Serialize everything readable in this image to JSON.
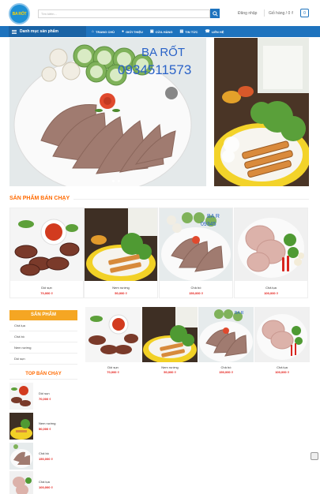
{
  "header": {
    "logo_text": "BA RỐT",
    "search_placeholder": "Tìm kiếm...",
    "login": "Đăng nhập",
    "cart": "Giỏ hàng / 0 ₫",
    "cart_count": "0"
  },
  "nav": {
    "category_menu": "Danh mục sản phẩm",
    "items": [
      {
        "label": "TRANG CHỦ",
        "icon": "home-icon"
      },
      {
        "label": "GIỚI THIỆU",
        "icon": "info-icon"
      },
      {
        "label": "CỬA HÀNG",
        "icon": "cart-icon"
      },
      {
        "label": "TIN TỨC",
        "icon": "news-icon"
      },
      {
        "label": "LIÊN HỆ",
        "icon": "contact-icon"
      }
    ]
  },
  "hero": {
    "brand": "BA RỐT",
    "phone": "0934511573"
  },
  "best_sellers": {
    "title": "SẢN PHẨM BÁN CHẠY",
    "products": [
      {
        "name": "Dồi sụn",
        "price": "70,000 ₫"
      },
      {
        "name": "Nem nướng",
        "price": "50,000 ₫"
      },
      {
        "name": "Chả bò",
        "price": "150,000 ₫"
      },
      {
        "name": "Chả lụa",
        "price": "100,000 ₫"
      }
    ]
  },
  "sidebar": {
    "title": "SẢN PHẨM",
    "categories": [
      "Chả lụa",
      "Chả bò",
      "Nem nướng",
      "Dồi sụn"
    ],
    "top_title": "TOP BÁN CHẠY",
    "top_items": [
      {
        "name": "Dồi sụn",
        "price": "70,000 ₫"
      },
      {
        "name": "Nem nướng",
        "price": "50,000 ₫"
      },
      {
        "name": "Chả bò",
        "price": "150,000 ₫"
      },
      {
        "name": "Chả lụa",
        "price": "100,000 ₫"
      }
    ]
  },
  "grid": {
    "products": [
      {
        "name": "Dồi sụn",
        "price": "70,000 ₫"
      },
      {
        "name": "Nem nướng",
        "price": "50,000 ₫"
      },
      {
        "name": "Chả bò",
        "price": "150,000 ₫"
      },
      {
        "name": "Chả lụa",
        "price": "100,000 ₫"
      }
    ]
  },
  "colors": {
    "primary": "#1e73be",
    "accent": "#ff6a00",
    "price": "#e3150f",
    "sidebar_header": "#f5a623"
  }
}
